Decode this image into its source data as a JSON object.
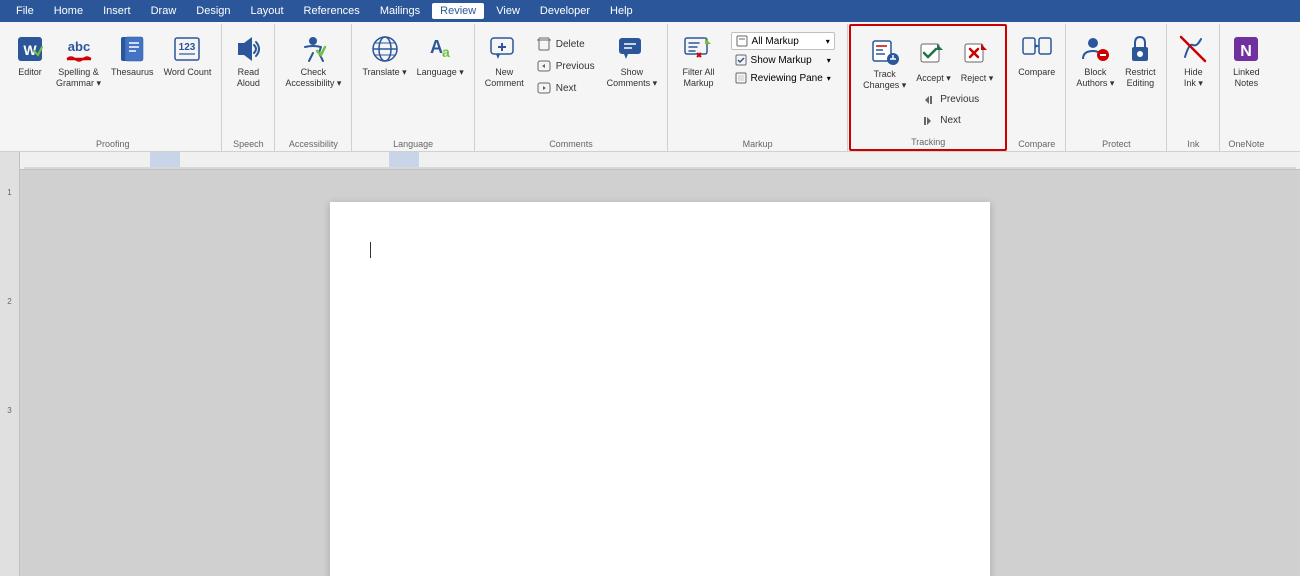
{
  "menubar": {
    "items": [
      "File",
      "Home",
      "Insert",
      "Draw",
      "Design",
      "Layout",
      "References",
      "Mailings",
      "Review",
      "View",
      "Developer",
      "Help"
    ],
    "active": "Review"
  },
  "ribbon": {
    "groups": {
      "proofing": {
        "label": "Proofing",
        "buttons": [
          {
            "id": "editor",
            "icon": "✏️",
            "label": "Editor",
            "dropdown": false
          },
          {
            "id": "spelling",
            "icon": "abc",
            "label": "Spelling &\nGrammar",
            "dropdown": true
          },
          {
            "id": "thesaurus",
            "icon": "📖",
            "label": "Thesaurus",
            "dropdown": false
          },
          {
            "id": "word-count",
            "icon": "123",
            "label": "Word Count",
            "dropdown": false
          }
        ]
      },
      "speech": {
        "label": "Speech",
        "buttons": [
          {
            "id": "read-aloud",
            "icon": "🔊",
            "label": "Read\nAloud",
            "dropdown": false
          }
        ]
      },
      "accessibility": {
        "label": "Accessibility",
        "buttons": [
          {
            "id": "check-accessibility",
            "icon": "✓",
            "label": "Check\nAccessibility",
            "dropdown": true
          }
        ]
      },
      "language": {
        "label": "Language",
        "buttons": [
          {
            "id": "translate",
            "icon": "🌐",
            "label": "Translate",
            "dropdown": true
          },
          {
            "id": "language",
            "icon": "A",
            "label": "Language",
            "dropdown": true
          }
        ]
      },
      "comments": {
        "label": "Comments",
        "buttons": [
          {
            "id": "new-comment",
            "icon": "💬",
            "label": "New\nComment",
            "dropdown": false
          },
          {
            "id": "delete",
            "icon": "🗑️",
            "label": "Delete",
            "dropdown": false
          },
          {
            "id": "previous",
            "icon": "◀",
            "label": "Previous",
            "dropdown": false
          },
          {
            "id": "next",
            "icon": "▶",
            "label": "Next",
            "dropdown": false
          },
          {
            "id": "show-comments",
            "icon": "💬",
            "label": "Show\nComments",
            "dropdown": true
          }
        ]
      },
      "markup": {
        "label": "Markup",
        "dropdown_label": "All Markup",
        "show_markup": "Show Markup",
        "reviewing_pane": "Reviewing Pane",
        "filter_label": "Filter All\nMarkup"
      },
      "tracking": {
        "label": "Tracking",
        "buttons": [
          {
            "id": "track-changes",
            "icon": "📝",
            "label": "Track\nChanges",
            "dropdown": true
          },
          {
            "id": "accept",
            "icon": "✓",
            "label": "Accept",
            "dropdown": true
          },
          {
            "id": "reject",
            "icon": "✕",
            "label": "Reject",
            "dropdown": true
          }
        ],
        "small_buttons": [
          {
            "id": "previous-change",
            "label": "Previous"
          },
          {
            "id": "next-change",
            "label": "Next"
          }
        ]
      },
      "compare": {
        "label": "Compare",
        "buttons": [
          {
            "id": "compare",
            "icon": "⊞",
            "label": "Compare",
            "dropdown": false
          }
        ]
      },
      "protect": {
        "label": "Protect",
        "buttons": [
          {
            "id": "block-authors",
            "icon": "🔒",
            "label": "Block\nAuthors",
            "dropdown": true
          },
          {
            "id": "restrict-editing",
            "icon": "🔒",
            "label": "Restrict\nEditing",
            "dropdown": false
          }
        ]
      },
      "ink": {
        "label": "Ink",
        "buttons": [
          {
            "id": "hide-ink",
            "icon": "✒️",
            "label": "Hide\nInk",
            "dropdown": true
          }
        ]
      },
      "onenote": {
        "label": "OneNote",
        "buttons": [
          {
            "id": "linked-notes",
            "icon": "N",
            "label": "Linked\nNotes",
            "dropdown": false
          }
        ]
      }
    }
  }
}
